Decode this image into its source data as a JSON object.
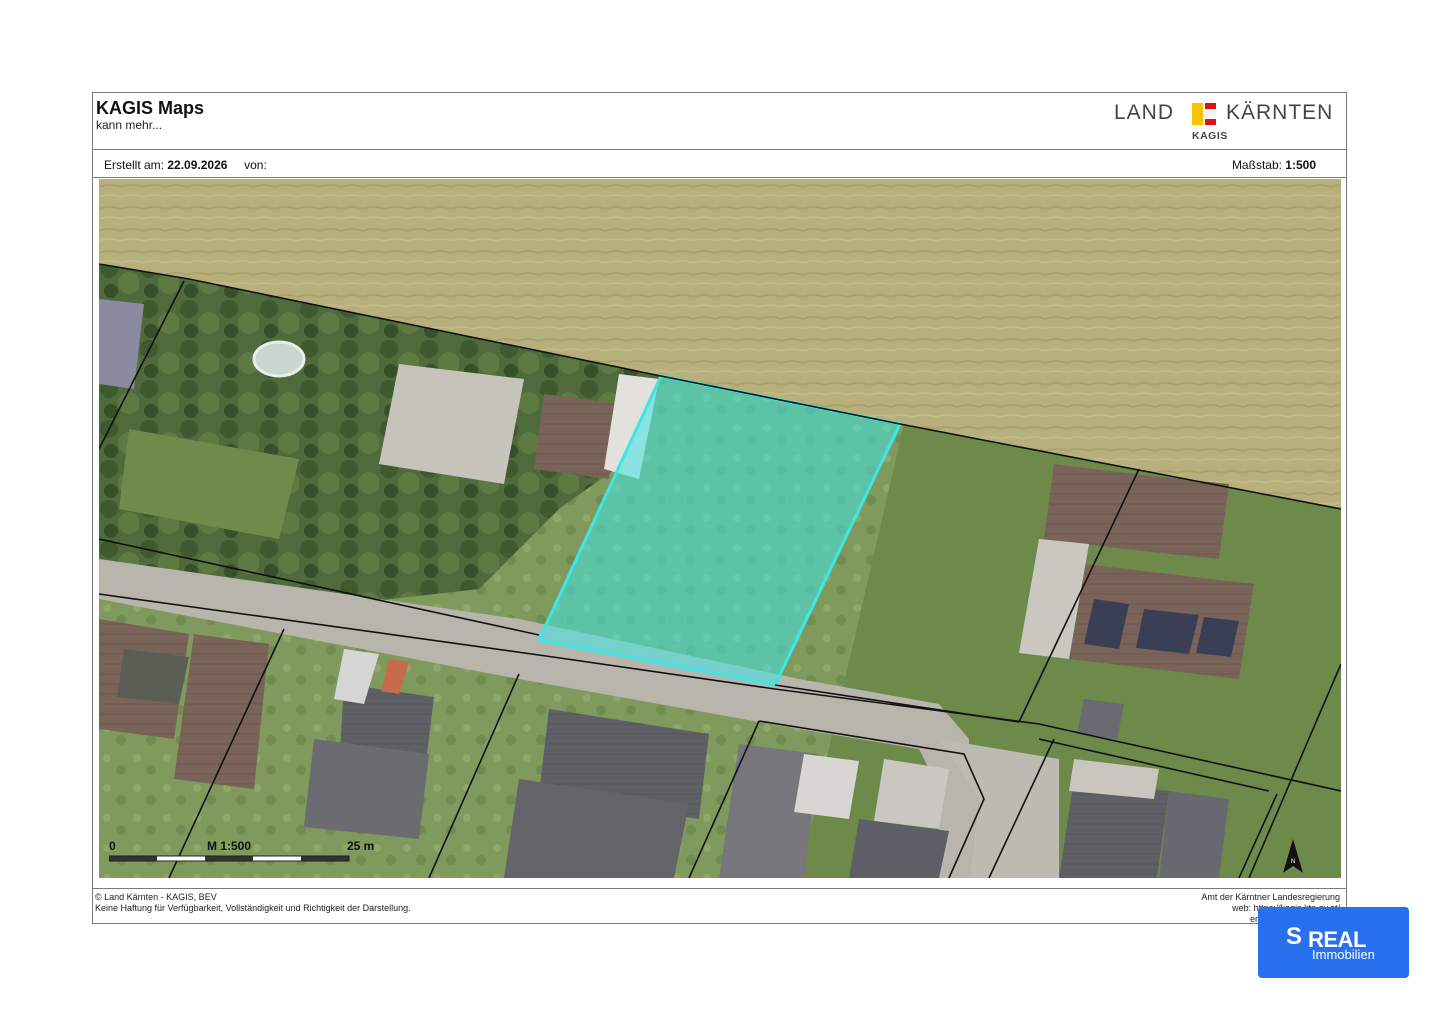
{
  "header": {
    "title": "KAGIS Maps",
    "subtitle": "kann mehr...",
    "logo_left": "LAND",
    "logo_right": "KÄRNTEN",
    "logo_sub": "KAGIS"
  },
  "info": {
    "created_label": "Erstellt am:",
    "created_date": "22.09.2026",
    "by_label": "von:",
    "scale_label": "Maßstab:",
    "scale_value": "1:500"
  },
  "map": {
    "scalebar": {
      "start": "0",
      "middle": "M 1:500",
      "end": "25 m"
    },
    "north_label": "N",
    "highlight_color": "#3fe6e6",
    "parcel_line_color": "#111111"
  },
  "footer": {
    "left_line1": "© Land Kärnten - KAGIS, BEV",
    "left_line2": "Keine Haftung für Verfügbarkeit, Vollständigkeit und Richtigkeit der Darstellung.",
    "right_line1": "Amt der Kärntner Landesregierung",
    "right_line2": "web: https://kagis.ktn.gv.at/",
    "right_line3": "email: kagis@ktn.gv.at"
  },
  "badge": {
    "symbol": "S",
    "word": "REAL",
    "sub": "Immobilien",
    "color": "#2870ed"
  }
}
